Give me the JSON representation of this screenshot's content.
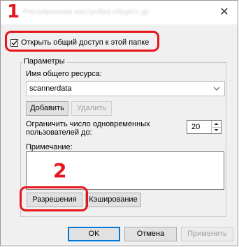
{
  "dialog": {
    "title": "Расширенная настройка общего доступа",
    "share_checkbox_label": "Открыть общий доступ к этой папке",
    "share_checked": true,
    "params_group_label": "Параметры",
    "share_name_label": "Имя общего ресурса:",
    "share_name_value": "scannerdata",
    "add_label": "Добавить",
    "remove_label": "Удалить",
    "limit_label_line1": "Ограничить число одновременных",
    "limit_label_line2": "пользователей до:",
    "limit_value": "20",
    "comment_label": "Примечание:",
    "permissions_label": "Разрешения",
    "caching_label": "Кэширование",
    "ok_label": "OK",
    "cancel_label": "Отмена",
    "apply_label": "Применить"
  },
  "annotations": {
    "step1": "1",
    "step2": "2",
    "color": "#e8141b"
  }
}
